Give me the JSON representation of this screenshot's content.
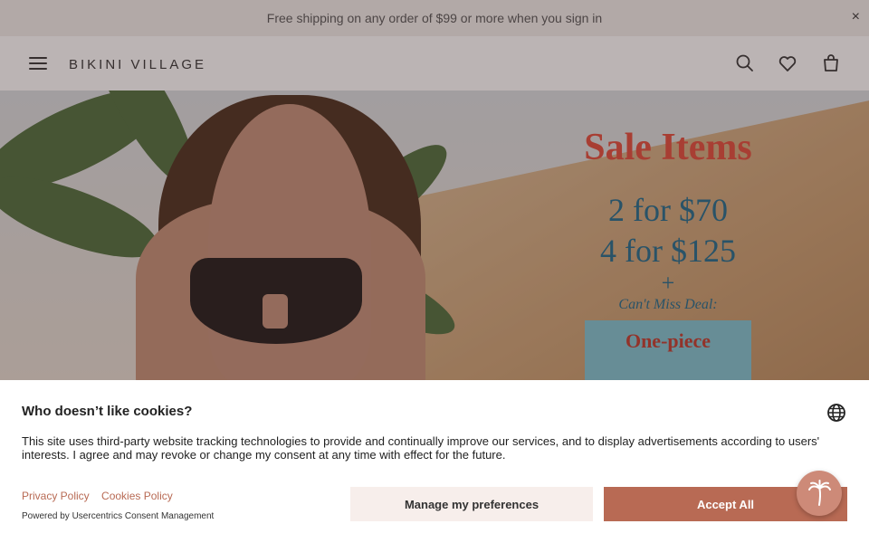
{
  "promo": {
    "text": "Free shipping on any order of $99 or more when you sign in",
    "close": "×"
  },
  "header": {
    "logo": "BIKINI VILLAGE",
    "icons": [
      "menu-icon",
      "search-icon",
      "heart-icon",
      "bag-icon"
    ]
  },
  "hero": {
    "title": "Sale Items",
    "deal1": "2 for $70",
    "deal2": "4 for $125",
    "plus": "+",
    "cant_miss": "Can't Miss Deal:",
    "one_piece": "One-piece"
  },
  "cookie": {
    "title": "Who doesn’t like cookies?",
    "text": "This site uses third-party website tracking technologies to provide and continually improve our services, and to display advertisements according to users' interests. I agree and may revoke or change my consent at any time with effect for the future.",
    "privacy_link": "Privacy Policy",
    "cookies_link": "Cookies Policy",
    "powered_by": "Powered by Usercentrics Consent Management",
    "manage_label": "Manage my preferences",
    "accept_label": "Accept All"
  },
  "colors": {
    "accent": "#b86a54",
    "manage_bg": "#f7eeeb",
    "sale_red": "#e24a3a",
    "deal_blue": "#1f6a8a"
  }
}
